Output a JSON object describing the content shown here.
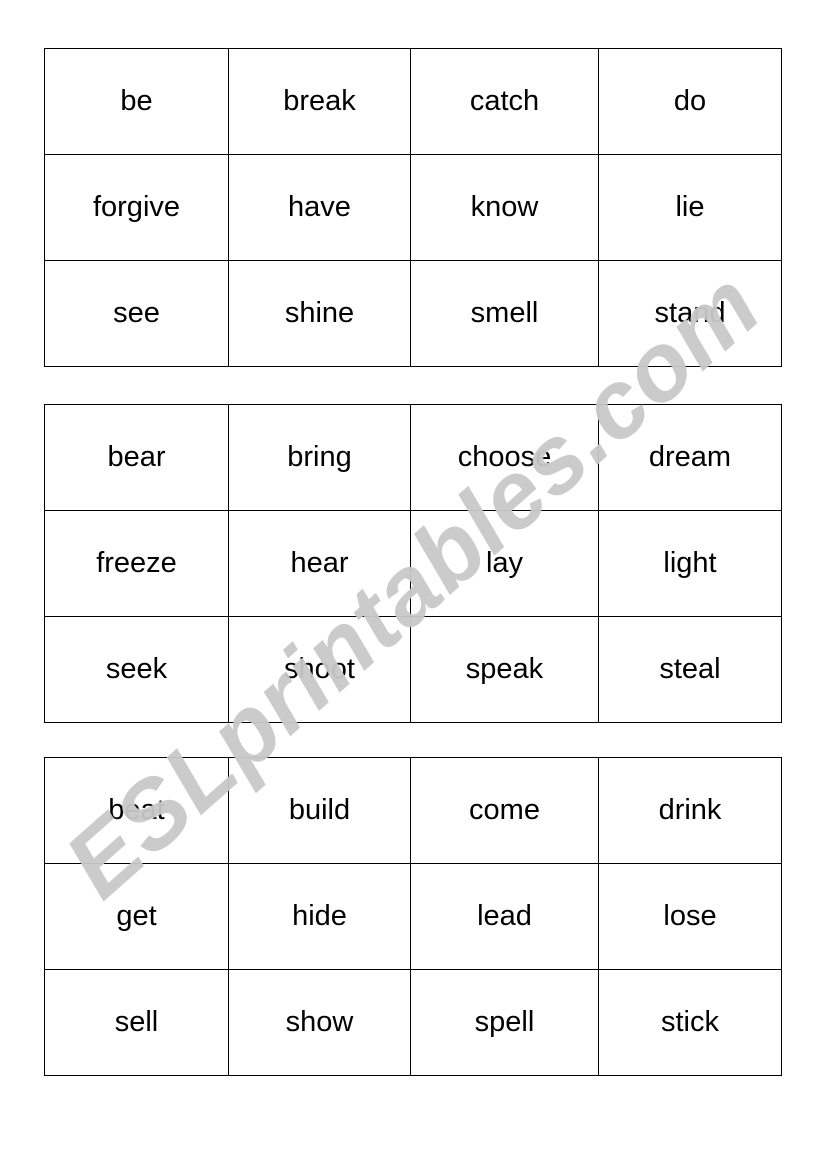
{
  "document": {
    "title": "Irregular Verbs Cards",
    "watermark": "ESLprintables.com",
    "background_color": "#ffffff",
    "border_color": "#000000",
    "text_color": "#000000",
    "watermark_color": "#c9c9c9"
  },
  "tables": [
    {
      "id": "table-1",
      "rows": [
        [
          "be",
          "break",
          "catch",
          "do"
        ],
        [
          "forgive",
          "have",
          "know",
          "lie"
        ],
        [
          "see",
          "shine",
          "smell",
          "stand"
        ]
      ]
    },
    {
      "id": "table-2",
      "rows": [
        [
          "bear",
          "bring",
          "choose",
          "dream"
        ],
        [
          "freeze",
          "hear",
          "lay",
          "light"
        ],
        [
          "seek",
          "shoot",
          "speak",
          "steal"
        ]
      ]
    },
    {
      "id": "table-3",
      "rows": [
        [
          "beat",
          "build",
          "come",
          "drink"
        ],
        [
          "get",
          "hide",
          "lead",
          "lose"
        ],
        [
          "sell",
          "show",
          "spell",
          "stick"
        ]
      ]
    }
  ]
}
